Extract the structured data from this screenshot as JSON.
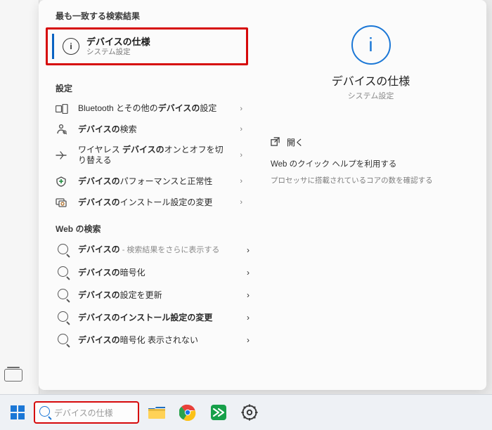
{
  "best_match_header": "最も一致する検索結果",
  "best_match": {
    "title": "デバイスの仕様",
    "subtitle": "システム設定"
  },
  "settings_header": "設定",
  "settings": [
    {
      "label_pre": "Bluetooth とその他の",
      "label_bold": "デバイスの",
      "label_post": "設定",
      "icon": "bluetooth-devices-icon"
    },
    {
      "label_pre": "",
      "label_bold": "デバイスの",
      "label_post": "検索",
      "icon": "find-device-icon"
    },
    {
      "label_pre": "ワイヤレス ",
      "label_bold": "デバイスの",
      "label_post": "オンとオフを切り替える",
      "icon": "airplane-icon"
    },
    {
      "label_pre": "",
      "label_bold": "デバイスの",
      "label_post": "パフォーマンスと正常性",
      "icon": "health-icon"
    },
    {
      "label_pre": "",
      "label_bold": "デバイスの",
      "label_post": "インストール設定の変更",
      "icon": "install-settings-icon"
    }
  ],
  "web_header": "Web の検索",
  "web": [
    {
      "label_bold": "デバイスの",
      "label_post": "",
      "suffix": " - 検索結果をさらに表示する"
    },
    {
      "label_bold": "デバイスの",
      "label_post": "暗号化",
      "suffix": ""
    },
    {
      "label_bold": "デバイスの",
      "label_post": "設定を更新",
      "suffix": ""
    },
    {
      "label_bold": "デバイスの",
      "label_post": "インストール設定の変更",
      "suffix": ""
    },
    {
      "label_bold": "デバイスの",
      "label_post": "暗号化 表示されない",
      "suffix": ""
    }
  ],
  "preview": {
    "title": "デバイスの仕様",
    "subtitle": "システム設定",
    "open_label": "開く",
    "help_header": "Web のクイック ヘルプを利用する",
    "help_item": "プロセッサに搭載されているコアの数を確認する"
  },
  "taskbar": {
    "search_value": "デバイスの仕様"
  }
}
